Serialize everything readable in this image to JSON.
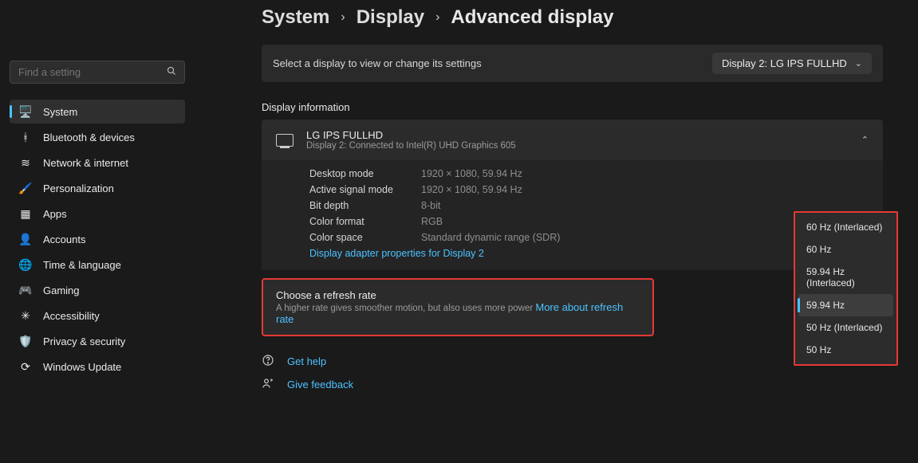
{
  "search": {
    "placeholder": "Find a setting"
  },
  "nav": [
    {
      "label": "System",
      "icon": "🖥️",
      "active": true
    },
    {
      "label": "Bluetooth & devices",
      "icon": "ᚼ",
      "active": false
    },
    {
      "label": "Network & internet",
      "icon": "≋",
      "active": false
    },
    {
      "label": "Personalization",
      "icon": "🖌️",
      "active": false
    },
    {
      "label": "Apps",
      "icon": "▦",
      "active": false
    },
    {
      "label": "Accounts",
      "icon": "👤",
      "active": false
    },
    {
      "label": "Time & language",
      "icon": "🌐",
      "active": false
    },
    {
      "label": "Gaming",
      "icon": "🎮",
      "active": false
    },
    {
      "label": "Accessibility",
      "icon": "✳",
      "active": false
    },
    {
      "label": "Privacy & security",
      "icon": "🛡️",
      "active": false
    },
    {
      "label": "Windows Update",
      "icon": "⟳",
      "active": false
    }
  ],
  "breadcrumb": {
    "a": "System",
    "b": "Display",
    "c": "Advanced display"
  },
  "selectBar": {
    "label": "Select a display to view or change its settings",
    "value": "Display 2: LG IPS FULLHD"
  },
  "section": {
    "title": "Display information"
  },
  "displayCard": {
    "name": "LG IPS FULLHD",
    "sub": "Display 2: Connected to Intel(R) UHD Graphics 605",
    "rows": {
      "desktopMode": {
        "k": "Desktop mode",
        "v": "1920 × 1080, 59.94 Hz"
      },
      "activeSignal": {
        "k": "Active signal mode",
        "v": "1920 × 1080, 59.94 Hz"
      },
      "bitDepth": {
        "k": "Bit depth",
        "v": "8-bit"
      },
      "colorFormat": {
        "k": "Color format",
        "v": "RGB"
      },
      "colorSpace": {
        "k": "Color space",
        "v": "Standard dynamic range (SDR)"
      }
    },
    "adapterLink": "Display adapter properties for Display 2"
  },
  "refresh": {
    "title": "Choose a refresh rate",
    "desc": "A higher rate gives smoother motion, but also uses more power  ",
    "more": "More about refresh rate",
    "options": [
      {
        "label": "60 Hz (Interlaced)",
        "selected": false
      },
      {
        "label": "60 Hz",
        "selected": false
      },
      {
        "label": "59.94 Hz (Interlaced)",
        "selected": false
      },
      {
        "label": "59.94 Hz",
        "selected": true
      },
      {
        "label": "50 Hz (Interlaced)",
        "selected": false
      },
      {
        "label": "50 Hz",
        "selected": false
      }
    ]
  },
  "footer": {
    "help": "Get help",
    "feedback": "Give feedback"
  }
}
